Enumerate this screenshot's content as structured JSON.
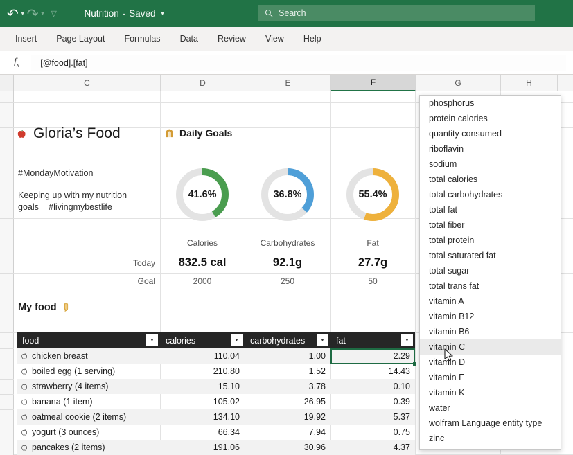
{
  "titlebar": {
    "undo_icon": "undo-icon",
    "redo_icon": "redo-icon",
    "customize_icon": "customize-quick-access-icon",
    "doc_name": "Nutrition",
    "separator": "-",
    "save_state": "Saved",
    "caret": "▾"
  },
  "search": {
    "placeholder": "Search",
    "icon": "search-icon"
  },
  "ribbon": {
    "tabs": [
      {
        "label": "Insert"
      },
      {
        "label": "Page Layout"
      },
      {
        "label": "Formulas"
      },
      {
        "label": "Data"
      },
      {
        "label": "Review"
      },
      {
        "label": "View"
      },
      {
        "label": "Help"
      }
    ]
  },
  "formula_bar": {
    "fx_label": "fx",
    "value": "=[@food].[fat]"
  },
  "grid": {
    "columns": [
      {
        "label": "C",
        "active": false
      },
      {
        "label": "D",
        "active": false
      },
      {
        "label": "E",
        "active": false
      },
      {
        "label": "F",
        "active": true
      },
      {
        "label": "G",
        "active": false
      },
      {
        "label": "H",
        "active": false
      }
    ]
  },
  "dashboard": {
    "brand_icon": "apple-icon",
    "brand_title": "Gloria’s Food",
    "goals_icon": "daily-goals-icon",
    "goals_title": "Daily Goals",
    "motto_line1": "#MondayMotivation",
    "motto_line2": "Keeping up with my nutrition",
    "motto_line3": "goals = #livingmybestlife",
    "donuts": [
      {
        "name": "calories-progress",
        "value": "41.6%",
        "pct": 41.6,
        "color": "#4a9d4f"
      },
      {
        "name": "carbohydrates-progress",
        "value": "36.8%",
        "pct": 36.8,
        "color": "#4f9fd8"
      },
      {
        "name": "fat-progress",
        "value": "55.4%",
        "pct": 55.4,
        "color": "#eeb13c"
      }
    ],
    "metric_headers": [
      "Calories",
      "Carbohydrates",
      "Fat"
    ],
    "today_label": "Today",
    "today_values": [
      "832.5 cal",
      "92.1g",
      "27.7g"
    ],
    "goal_label": "Goal",
    "goal_values": [
      "2000",
      "250",
      "50"
    ],
    "myfood_label": "My food",
    "myfood_icon": "tag-icon"
  },
  "table": {
    "headers": [
      "food",
      "calories",
      "carbohydrates",
      "fat"
    ],
    "filter_icon": "filter-dropdown-icon",
    "row_icon": "apple-icon",
    "rows": [
      {
        "food": "chicken breast",
        "calories": "110.04",
        "carbohydrates": "1.00",
        "fat": "2.29"
      },
      {
        "food": "boiled egg (1 serving)",
        "calories": "210.80",
        "carbohydrates": "1.52",
        "fat": "14.43"
      },
      {
        "food": "strawberry (4 items)",
        "calories": "15.10",
        "carbohydrates": "3.78",
        "fat": "0.10"
      },
      {
        "food": "banana (1 item)",
        "calories": "105.02",
        "carbohydrates": "26.95",
        "fat": "0.39"
      },
      {
        "food": "oatmeal cookie (2 items)",
        "calories": "134.10",
        "carbohydrates": "19.92",
        "fat": "5.37"
      },
      {
        "food": "yogurt (3 ounces)",
        "calories": "66.34",
        "carbohydrates": "7.94",
        "fat": "0.75"
      },
      {
        "food": "pancakes (2 items)",
        "calories": "191.06",
        "carbohydrates": "30.96",
        "fat": "4.37"
      }
    ],
    "selected_cell": "F row chicken breast fat"
  },
  "dropdown": {
    "selected": "vitamin C",
    "cursor_icon": "mouse-pointer-icon",
    "items": [
      {
        "label": "phosphorus"
      },
      {
        "label": "protein calories"
      },
      {
        "label": "quantity consumed"
      },
      {
        "label": "riboflavin"
      },
      {
        "label": "sodium"
      },
      {
        "label": "total calories"
      },
      {
        "label": "total carbohydrates"
      },
      {
        "label": "total fat"
      },
      {
        "label": "total fiber"
      },
      {
        "label": "total protein"
      },
      {
        "label": "total saturated fat"
      },
      {
        "label": "total sugar"
      },
      {
        "label": "total trans fat"
      },
      {
        "label": "vitamin A"
      },
      {
        "label": "vitamin B12"
      },
      {
        "label": "vitamin B6"
      },
      {
        "label": "vitamin C"
      },
      {
        "label": "vitamin D"
      },
      {
        "label": "vitamin E"
      },
      {
        "label": "vitamin K"
      },
      {
        "label": "water"
      },
      {
        "label": "wolfram Language entity type"
      },
      {
        "label": "zinc"
      }
    ]
  },
  "colors": {
    "brand_green": "#217346",
    "table_header": "#262626",
    "selection_border": "#1e6b43"
  }
}
